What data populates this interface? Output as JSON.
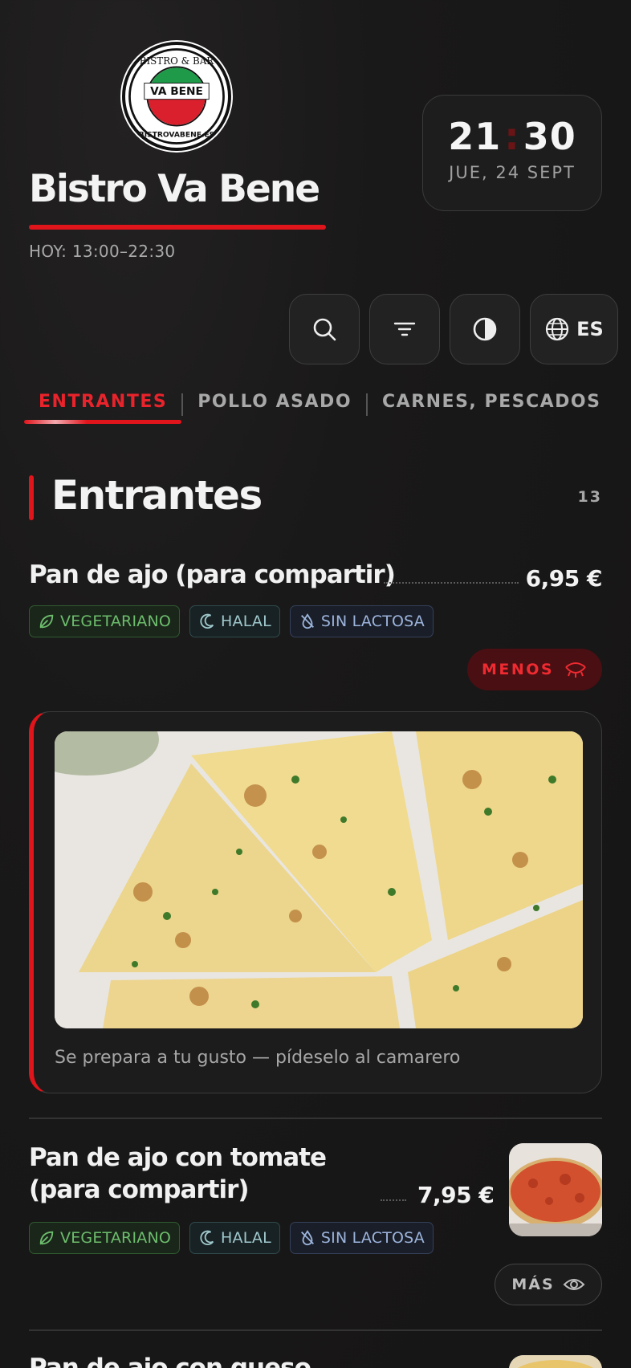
{
  "header": {
    "logo_text": "BISTRO & BAR VA BENE BISTROVABENE.ES",
    "title": "Bistro Va Bene",
    "hours": "HOY: 13:00–22:30",
    "clock": {
      "hours": "21",
      "separator": ":",
      "minutes": "30",
      "date": "JUE, 24 SEPT"
    }
  },
  "toolbar": {
    "search_icon": "search-icon",
    "filter_icon": "filter-icon",
    "theme_icon": "contrast-icon",
    "language": "ES"
  },
  "tabs": [
    {
      "label": "ENTRANTES",
      "active": true
    },
    {
      "label": "POLLO ASADO",
      "active": false
    },
    {
      "label": "CARNES, PESCADOS",
      "active": false
    }
  ],
  "section": {
    "title": "Entrantes",
    "count": "13"
  },
  "items": [
    {
      "name": "Pan de ajo (para compartir)",
      "price": "6,95 €",
      "tags": [
        "VEGETARIANO",
        "HALAL",
        "SIN LACTOSA"
      ],
      "toggle_label": "MENOS",
      "note": "Se prepara a tu gusto — pídeselo al camarero"
    },
    {
      "name_line1": "Pan de ajo con tomate",
      "name_line2": "(para compartir)",
      "price": "7,95 €",
      "tags": [
        "VEGETARIANO",
        "HALAL",
        "SIN LACTOSA"
      ],
      "toggle_label": "MÁS"
    },
    {
      "name": "Pan de ajo con queso"
    }
  ],
  "colors": {
    "accent": "#e0141b",
    "background": "#161515"
  }
}
